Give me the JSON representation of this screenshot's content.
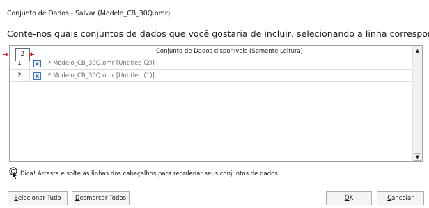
{
  "window": {
    "title": "Conjunto de Dados - Salvar (Modelo_CB_30Q.omr)"
  },
  "instruction": "Conte-nos quais conjuntos de dados que você gostaria de incluir, selecionando a linha correspondente na lista abaixo:",
  "grid": {
    "header": {
      "drag_number": "2",
      "title": "Conjunto de Dados disponíveis (Somente Leitura)"
    },
    "rows": [
      {
        "num": "1",
        "checked": "x",
        "name": "* Modelo_CB_30Q.omr [Untitled (2)]"
      },
      {
        "num": "2",
        "checked": "x",
        "name": "* Modelo_CB_30Q.omr [Untitled (1)]"
      }
    ],
    "scroll_up": "▲",
    "scroll_down": "▼"
  },
  "hint": {
    "icon": "hand-pointer-icon",
    "text": "Dica! Arraste e solte as linhas dos cabeçalhos para reordenar seus conjuntos de dados."
  },
  "buttons": {
    "select_all": {
      "mnemonic": "S",
      "rest": "elecionar Tudo"
    },
    "deselect_all": {
      "mnemonic": "D",
      "rest": "esmarcar Todos"
    },
    "ok": {
      "mnemonic": "O",
      "rest": "K"
    },
    "cancel": {
      "mnemonic": "C",
      "rest": "ancelar"
    }
  },
  "colors": {
    "drop_marker": "#e02020",
    "checkbox_border": "#3a6fc4"
  }
}
